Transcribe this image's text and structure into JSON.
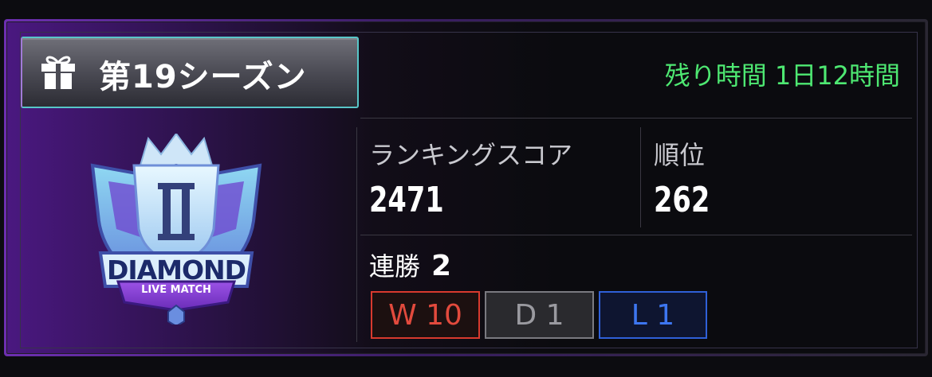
{
  "season": {
    "title": "第19シーズン",
    "gift_icon": "gift-icon"
  },
  "time_remaining": "残り時間 1日12時間",
  "rank": {
    "tier_numeral": "II",
    "tier_name": "DIAMOND",
    "mode": "LIVE MATCH"
  },
  "stats": {
    "ranking_score_label": "ランキングスコア",
    "ranking_score_value": "2471",
    "rank_position_label": "順位",
    "rank_position_value": "262"
  },
  "streak": {
    "label": "連勝",
    "value": "2"
  },
  "record": {
    "wins": "W 10",
    "draws": "D 1",
    "losses": "L 1"
  },
  "colors": {
    "accent_green": "#4ee872",
    "win_red": "#e24a3d",
    "loss_blue": "#3d76f0",
    "purple": "#6d2fb0"
  }
}
